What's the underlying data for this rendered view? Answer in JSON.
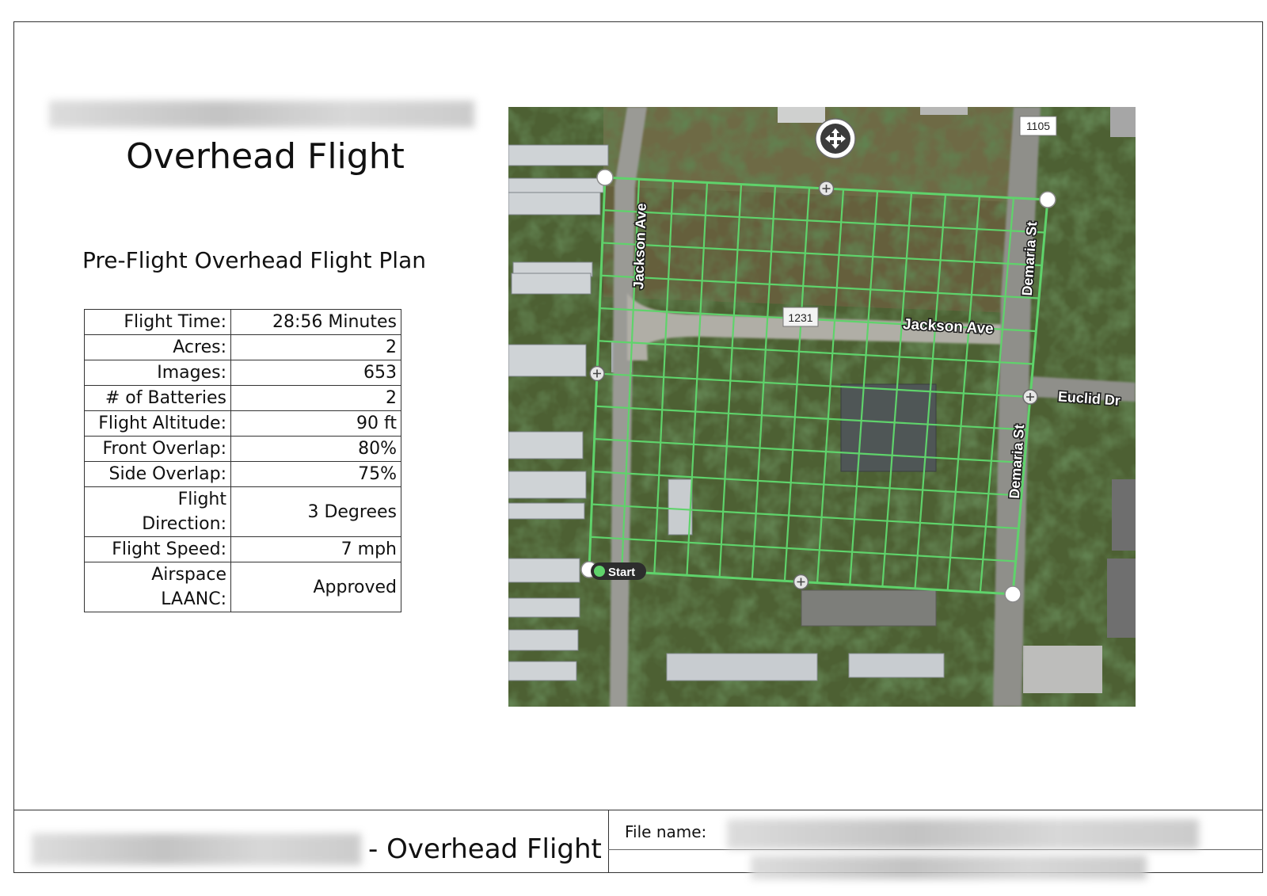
{
  "header": {
    "title": "Overhead Flight"
  },
  "plan": {
    "title": "Pre-Flight Overhead Flight Plan",
    "rows": [
      {
        "label": "Flight Time:",
        "value": "28:56 Minutes"
      },
      {
        "label": "Acres:",
        "value": "2"
      },
      {
        "label": "Images:",
        "value": "653"
      },
      {
        "label": "# of Batteries",
        "value": "2"
      },
      {
        "label": "Flight Altitude:",
        "value": "90 ft"
      },
      {
        "label": "Front Overlap:",
        "value": "80%"
      },
      {
        "label": "Side Overlap:",
        "value": "75%"
      },
      {
        "label": "Flight Direction:",
        "value": "3 Degrees"
      },
      {
        "label": "Flight Speed:",
        "value": "7 mph"
      },
      {
        "label": "Airspace LAANC:",
        "value": "Approved"
      }
    ]
  },
  "map": {
    "labels": {
      "jackson_ave_vertical": "Jackson Ave",
      "jackson_ave_horizontal": "Jackson Ave",
      "demaria_st_upper": "Demaria St",
      "demaria_st_lower": "Demaria St",
      "euclid_dr": "Euclid Dr",
      "address_1105": "1105",
      "address_1231": "1231",
      "start": "Start"
    },
    "colors": {
      "grid": "#5fd36b",
      "road": "#9a9a95",
      "terrain": "#4d6033"
    },
    "move_handle_icon": "move-arrows-icon"
  },
  "footer": {
    "title": "- Overhead Flight",
    "file_label": "File name:"
  }
}
